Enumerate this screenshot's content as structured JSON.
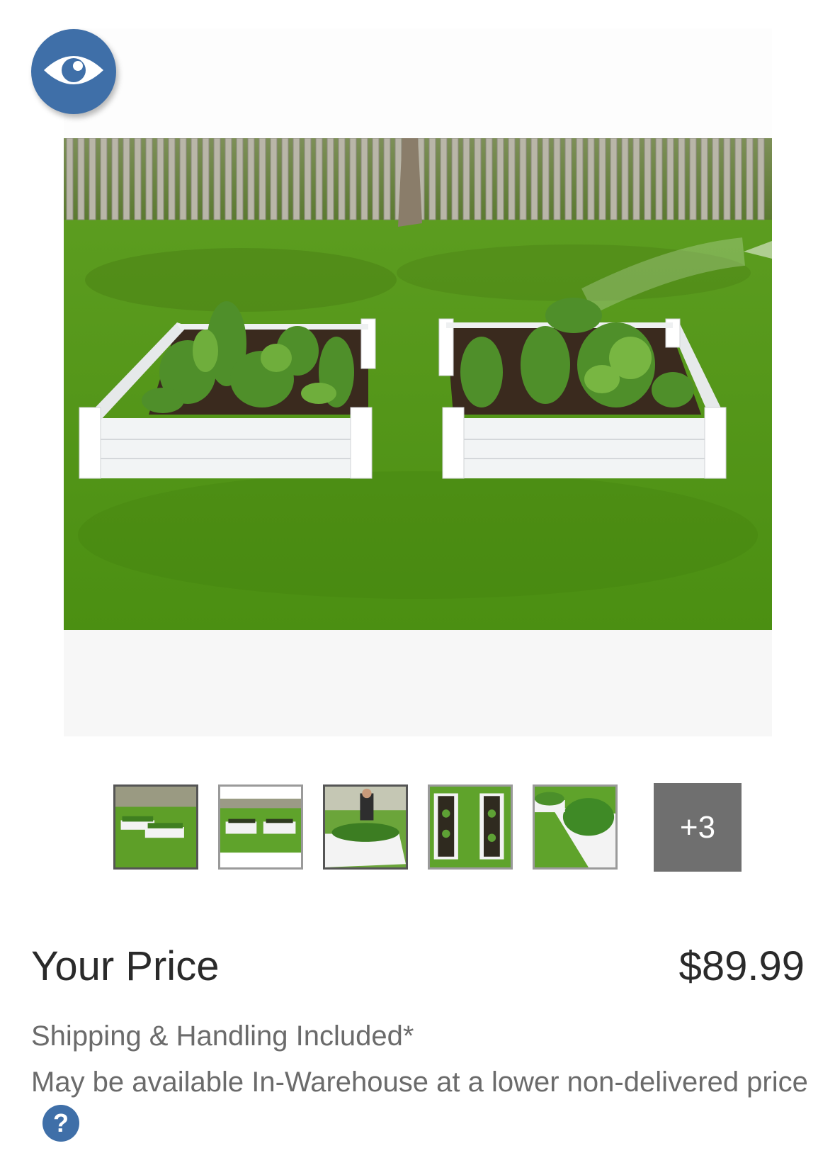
{
  "preview_button": {
    "icon": "eye-icon"
  },
  "gallery": {
    "main_image_alt": "Two white raised garden beds on lawn",
    "thumbnails": [
      {
        "name": "thumb-1",
        "active": true
      },
      {
        "name": "thumb-2",
        "active": false
      },
      {
        "name": "thumb-3",
        "active": false
      },
      {
        "name": "thumb-4",
        "active": false
      },
      {
        "name": "thumb-5",
        "active": false
      }
    ],
    "more_label": "+3"
  },
  "pricing": {
    "label": "Your Price",
    "value": "$89.99",
    "shipping_note": "Shipping & Handling Included*",
    "warehouse_note": "May be available In-Warehouse at a lower non-delivered price"
  },
  "colors": {
    "accent_blue": "#3f6fa8",
    "more_tile_gray": "#6f6f6f",
    "muted_text": "#6b6b6b"
  }
}
